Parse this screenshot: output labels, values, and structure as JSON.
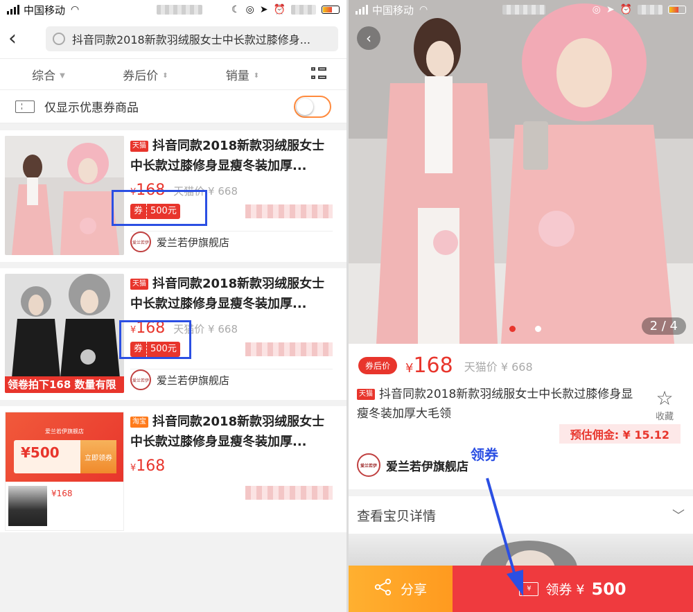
{
  "left": {
    "status": {
      "carrier": "中国移动"
    },
    "search": {
      "query": "抖音同款2018新款羽绒服女士中长款过膝修身..."
    },
    "sort": {
      "items": [
        "综合",
        "券后价",
        "销量"
      ]
    },
    "filter": {
      "label": "仅显示优惠券商品"
    },
    "products": [
      {
        "platform": "天猫",
        "title": "抖音同款2018新款羽绒服女士中长款过膝修身显瘦冬装加厚...",
        "price_symbol": "¥",
        "price": "168",
        "old_price": "天猫价 ¥ 668",
        "coupon_tag": "券",
        "coupon_value": "500元",
        "shop": "爱兰若伊旗舰店",
        "banner": ""
      },
      {
        "platform": "天猫",
        "title": "抖音同款2018新款羽绒服女士中长款过膝修身显瘦冬装加厚...",
        "price_symbol": "¥",
        "price": "168",
        "old_price": "天猫价 ¥ 668",
        "coupon_tag": "券",
        "coupon_value": "500元",
        "shop": "爱兰若伊旗舰店",
        "banner": "领卷拍下168   数量有限"
      },
      {
        "platform": "淘宝",
        "title": "抖音同款2018新款羽绒服女士中长款过膝修身显瘦冬装加厚...",
        "price_symbol": "¥",
        "price": "168",
        "coupon_image": {
          "shop": "爱兰若伊旗舰店",
          "amount": "¥500",
          "go": "立即领券",
          "price": "¥168"
        }
      }
    ]
  },
  "right": {
    "status": {
      "carrier": "中国移动"
    },
    "pager": "2 / 4",
    "after_coupon_label": "券后价",
    "price_symbol": "¥",
    "price": "168",
    "tmall_price": "天猫价 ¥ 668",
    "platform": "天猫",
    "title": "抖音同款2018新款羽绒服女士中长款过膝修身显瘦冬装加厚大毛领",
    "favorite_label": "收藏",
    "commission": "预估佣金: ¥ 15.12",
    "shop": "爱兰若伊旗舰店",
    "detail_label": "查看宝贝详情",
    "share_label": "分享",
    "claim_label": "领券 ¥",
    "claim_amount": "500",
    "annotation": "领券"
  },
  "colors": {
    "accent_red": "#e8352c",
    "annotation_blue": "#2b4fe3",
    "share_orange": "#ff9a1f"
  }
}
